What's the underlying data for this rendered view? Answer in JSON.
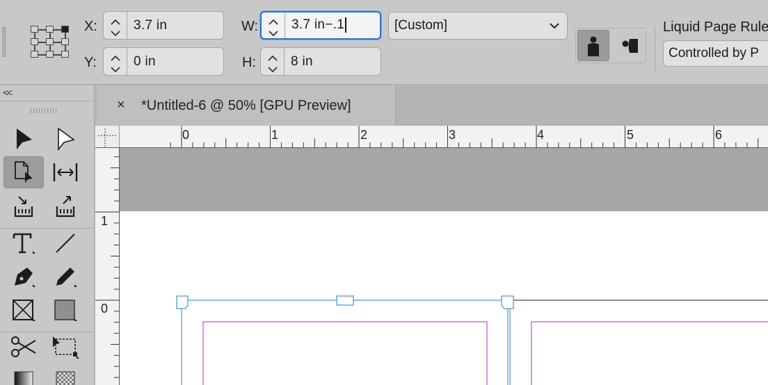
{
  "control_bar": {
    "x": {
      "label": "X:",
      "value": "3.7 in"
    },
    "y": {
      "label": "Y:",
      "value": "0 in"
    },
    "w": {
      "label": "W:",
      "value": "3.7 in−.1"
    },
    "h": {
      "label": "H:",
      "value": "8 in"
    },
    "size_preset": "[Custom]",
    "liquid_page_rule": {
      "label": "Liquid Page Rule",
      "value": "Controlled by P"
    }
  },
  "tools_panel": {
    "collapse_label": "<<",
    "tools": [
      "selection",
      "direct-selection",
      "page",
      "gap",
      "content-collector",
      "content-placer",
      "type",
      "line",
      "pen",
      "pencil",
      "rectangle-frame",
      "rectangle",
      "scissors",
      "free-transform",
      "gradient-swatch",
      "gradient-feather"
    ],
    "selected_tool": "page"
  },
  "document": {
    "tab_close": "×",
    "tab_title": "*Untitled-6 @ 50% [GPU Preview]",
    "ruler_h_labels": [
      "0",
      "1",
      "2",
      "3",
      "4",
      "5",
      "6"
    ],
    "ruler_v_labels": [
      "1",
      "0"
    ],
    "zoom": "50%"
  },
  "colors": {
    "selection_frame": "#4a9ad6",
    "margin_guide": "#c64bc6",
    "focus_ring": "#2a6fd6"
  }
}
